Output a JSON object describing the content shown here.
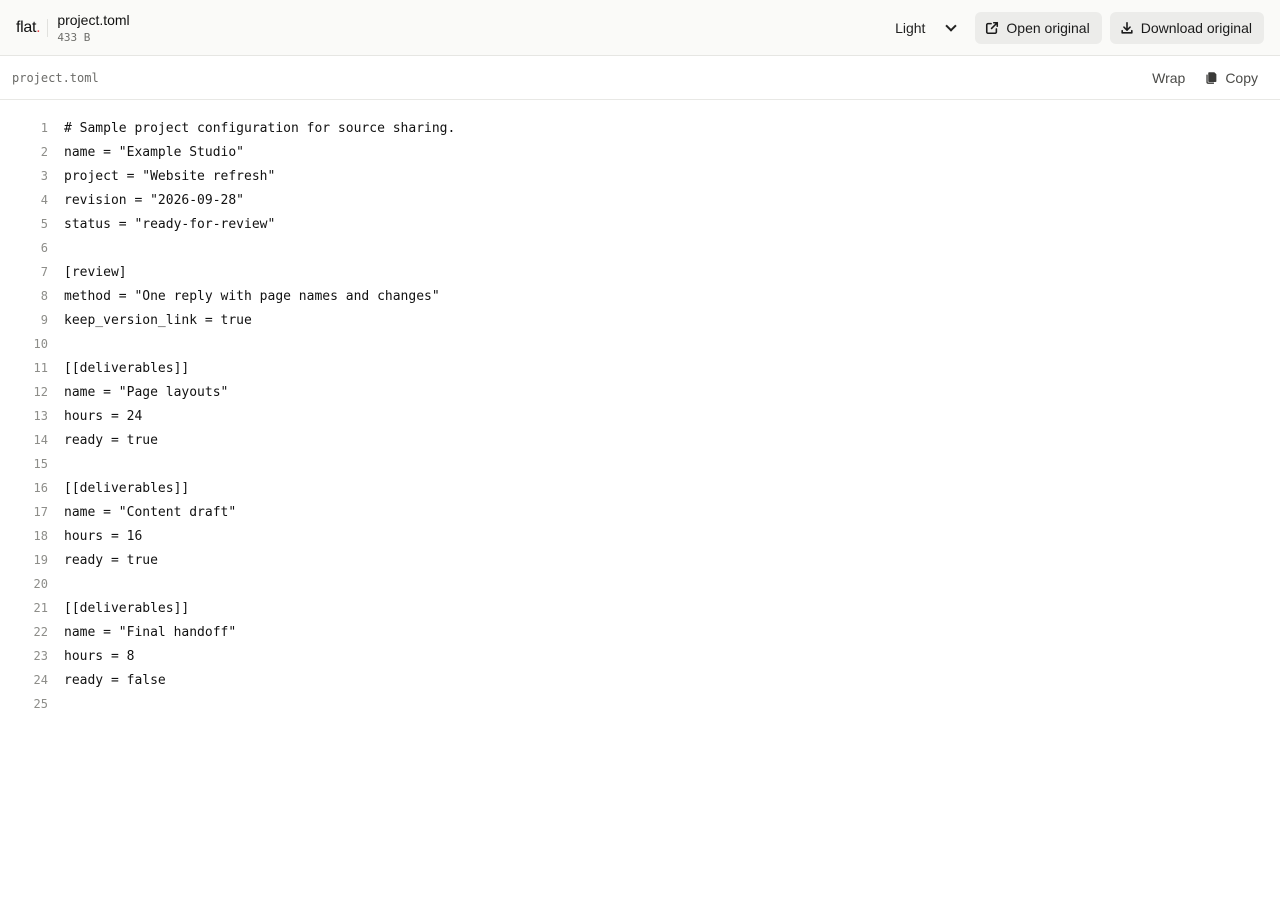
{
  "header": {
    "brand": "flat",
    "brand_dot": ".",
    "file_name": "project.toml",
    "file_size": "433 B",
    "theme": {
      "selected": "Light",
      "options": [
        "Light"
      ]
    },
    "open_label": "Open original",
    "download_label": "Download original"
  },
  "toolbar": {
    "path": "project.toml",
    "wrap_label": "Wrap",
    "copy_label": "Copy"
  },
  "code": {
    "lines": [
      {
        "n": "1",
        "text": "# Sample project configuration for source sharing."
      },
      {
        "n": "2",
        "text": "name = \"Example Studio\""
      },
      {
        "n": "3",
        "text": "project = \"Website refresh\""
      },
      {
        "n": "4",
        "text": "revision = \"2026-09-28\""
      },
      {
        "n": "5",
        "text": "status = \"ready-for-review\""
      },
      {
        "n": "6",
        "text": ""
      },
      {
        "n": "7",
        "text": "[review]"
      },
      {
        "n": "8",
        "text": "method = \"One reply with page names and changes\""
      },
      {
        "n": "9",
        "text": "keep_version_link = true"
      },
      {
        "n": "10",
        "text": ""
      },
      {
        "n": "11",
        "text": "[[deliverables]]"
      },
      {
        "n": "12",
        "text": "name = \"Page layouts\""
      },
      {
        "n": "13",
        "text": "hours = 24"
      },
      {
        "n": "14",
        "text": "ready = true"
      },
      {
        "n": "15",
        "text": ""
      },
      {
        "n": "16",
        "text": "[[deliverables]]"
      },
      {
        "n": "17",
        "text": "name = \"Content draft\""
      },
      {
        "n": "18",
        "text": "hours = 16"
      },
      {
        "n": "19",
        "text": "ready = true"
      },
      {
        "n": "20",
        "text": ""
      },
      {
        "n": "21",
        "text": "[[deliverables]]"
      },
      {
        "n": "22",
        "text": "name = \"Final handoff\""
      },
      {
        "n": "23",
        "text": "hours = 8"
      },
      {
        "n": "24",
        "text": "ready = false"
      },
      {
        "n": "25",
        "text": ""
      }
    ]
  },
  "colors": {
    "header_bg": "#fafaf8",
    "button_bg": "#ececea",
    "brand_dot": "#e5484d",
    "line_number": "#8d8d89"
  },
  "icons": {
    "open": "external-link-icon",
    "download": "download-icon",
    "copy": "copy-icon",
    "theme": "chevron-down-icon"
  }
}
